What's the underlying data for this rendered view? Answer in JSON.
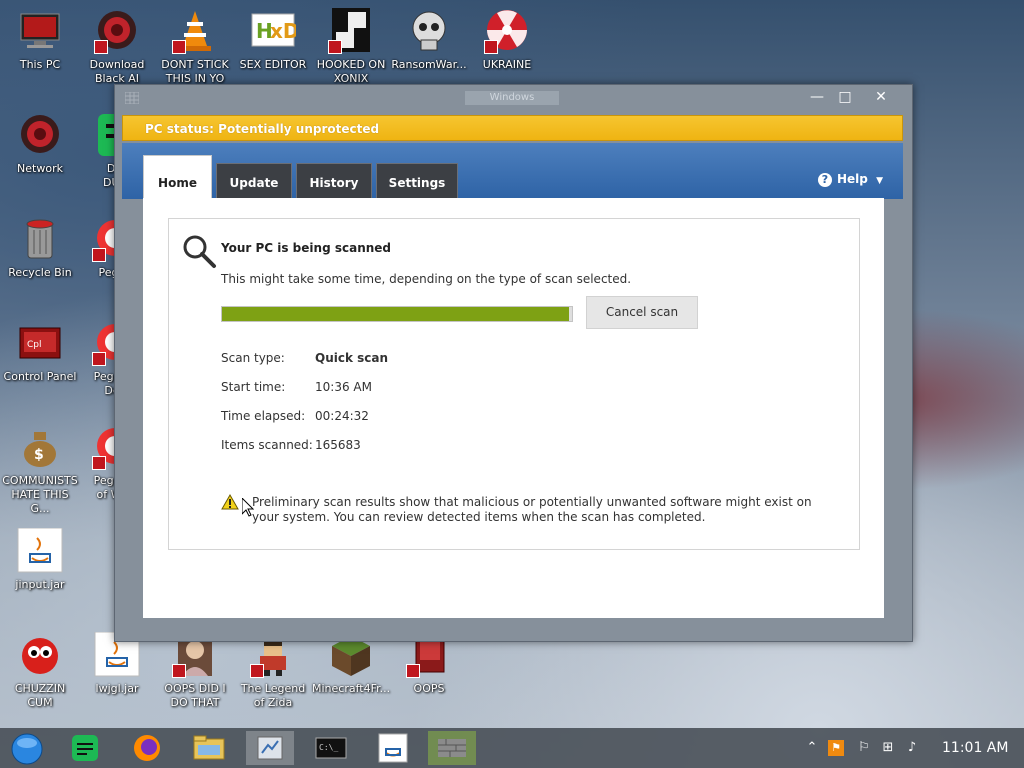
{
  "desktop_icons": [
    {
      "label": "This PC",
      "icon": "computer-icon"
    },
    {
      "label": "Download Black AI",
      "icon": "red-orb-icon"
    },
    {
      "label": "DONT STICK THIS IN YO",
      "icon": "vlc-cone-icon"
    },
    {
      "label": "SEX EDITOR",
      "icon": "hxd-icon"
    },
    {
      "label": "HOOKED ON XONIX",
      "icon": "xonix-icon"
    },
    {
      "label": "RansomWar...",
      "icon": "skull-icon"
    },
    {
      "label": "UKRAINE",
      "icon": "radiation-icon"
    },
    {
      "label": "Network",
      "icon": "red-orb-icon"
    },
    {
      "label": "D F DUM",
      "icon": "green-icon"
    },
    {
      "label": "Recycle Bin",
      "icon": "recycle-bin-icon"
    },
    {
      "label": "Pegg",
      "icon": "peggle-icon"
    },
    {
      "label": "Control Panel",
      "icon": "control-panel-icon"
    },
    {
      "label": "Peggle De",
      "icon": "peggle-icon"
    },
    {
      "label": "COMMUNISTS HATE THIS G...",
      "icon": "money-bag-icon"
    },
    {
      "label": "Peggle of Wa",
      "icon": "peggle-icon"
    },
    {
      "label": "jinput.jar",
      "icon": "java-icon"
    },
    {
      "label": "CHUZZIN CUM",
      "icon": "chuzzle-icon"
    },
    {
      "label": "lwjgl.jar",
      "icon": "java-icon"
    },
    {
      "label": "OOPS DID I DO THAT",
      "icon": "portrait-icon"
    },
    {
      "label": "The Legend of Zida",
      "icon": "pixel-hero-icon"
    },
    {
      "label": "Minecraft4Fr...",
      "icon": "minecraft-icon"
    },
    {
      "label": "OOPS",
      "icon": "red-app-icon"
    }
  ],
  "window": {
    "title": "Windows Defender",
    "controls": {
      "minimize": "—",
      "maximize": "□",
      "close": "✕"
    },
    "status": "PC status: Potentially unprotected",
    "tabs": [
      "Home",
      "Update",
      "History",
      "Settings"
    ],
    "active_tab": "Home",
    "help": "Help",
    "scan": {
      "heading": "Your PC is being scanned",
      "subtext": "This might take some time, depending on the type of scan selected.",
      "progress": 0.99,
      "cancel_label": "Cancel scan",
      "details": [
        {
          "label": "Scan type:",
          "value": "Quick scan"
        },
        {
          "label": "Start time:",
          "value": "10:36 AM"
        },
        {
          "label": "Time elapsed:",
          "value": "00:24:32"
        },
        {
          "label": "Items scanned:",
          "value": "165683"
        }
      ],
      "warning": "Preliminary scan results show that malicious or potentially unwanted software might exist on your system. You can review detected items when the scan has completed."
    }
  },
  "taskbar": {
    "clock": "11:01 AM",
    "items": [
      "start-orb-icon",
      "notes-icon",
      "firefox-icon",
      "file-explorer-icon",
      "defender-icon",
      "cmd-icon",
      "java-icon",
      "brick-wall-icon"
    ]
  },
  "colors": {
    "status_bar": "#f3bd22",
    "progress": "#7ea114",
    "header_blue": "#3a6fb2"
  }
}
